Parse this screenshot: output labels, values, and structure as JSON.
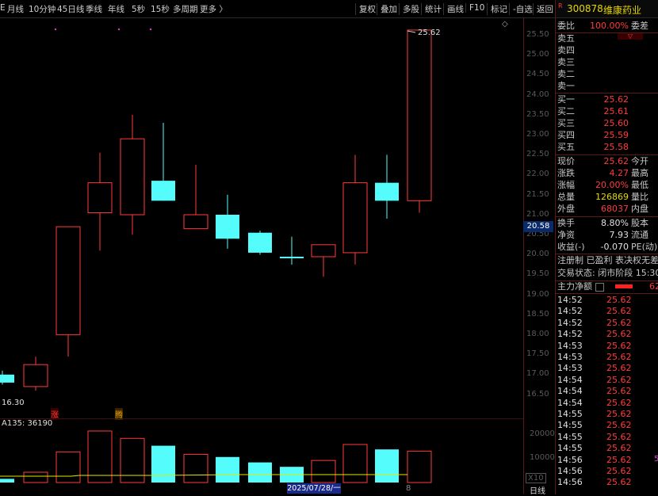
{
  "toolbar": {
    "left": [
      "月线",
      "10分钟",
      "45日线",
      "季线",
      "年线",
      "5秒",
      "15秒",
      "多周期",
      "更多 〉"
    ],
    "right": [
      "复权",
      "叠加",
      "多股",
      "统计",
      "画线",
      "F10",
      "标记",
      "-自选",
      "返回"
    ],
    "left_first": "E"
  },
  "chart": {
    "price_ticks": [
      "25.50",
      "25.00",
      "24.50",
      "24.00",
      "23.50",
      "23.00",
      "22.50",
      "22.00",
      "21.50",
      "21.00",
      "20.50",
      "20.00",
      "19.50",
      "19.00",
      "18.50",
      "18.00",
      "17.50",
      "17.00",
      "16.50"
    ],
    "current_price_box": "20.58",
    "high_label": "25.62",
    "low_label": "16.30",
    "marker_zhang": "涨",
    "marker_teng": "腾",
    "diamond": "◇",
    "vol_label": "A135: 36190",
    "vol_ticks": [
      "20000",
      "10000"
    ],
    "vol_unit": "X10",
    "date": "2025/07/28/一",
    "period_label": "日线",
    "bottom_mark": "8"
  },
  "chart_data": {
    "type": "candlestick",
    "candles": [
      {
        "o": 16.8,
        "c": 17.0,
        "h": 17.1,
        "l": 16.75,
        "color": "cyan"
      },
      {
        "o": 16.7,
        "c": 17.25,
        "h": 17.45,
        "l": 16.6,
        "color": "red"
      },
      {
        "o": 18.0,
        "c": 20.7,
        "h": 20.7,
        "l": 17.45,
        "color": "red"
      },
      {
        "o": 21.05,
        "c": 21.8,
        "h": 22.55,
        "l": 20.1,
        "color": "red"
      },
      {
        "o": 21.0,
        "c": 22.9,
        "h": 23.5,
        "l": 20.5,
        "color": "red"
      },
      {
        "o": 21.85,
        "c": 21.35,
        "h": 23.3,
        "l": 21.35,
        "color": "cyan"
      },
      {
        "o": 20.65,
        "c": 21.0,
        "h": 22.25,
        "l": 20.65,
        "color": "red"
      },
      {
        "o": 21.0,
        "c": 20.4,
        "h": 21.5,
        "l": 20.15,
        "color": "cyan"
      },
      {
        "o": 20.55,
        "c": 20.05,
        "h": 20.6,
        "l": 20.0,
        "color": "cyan"
      },
      {
        "o": 19.95,
        "c": 19.95,
        "h": 20.45,
        "l": 19.75,
        "color": "cyan"
      },
      {
        "o": 19.95,
        "c": 20.25,
        "h": 20.25,
        "l": 19.45,
        "color": "red"
      },
      {
        "o": 20.05,
        "c": 21.8,
        "h": 22.5,
        "l": 19.75,
        "color": "red"
      },
      {
        "o": 21.8,
        "c": 21.35,
        "h": 22.5,
        "l": 20.9,
        "color": "cyan"
      },
      {
        "o": 21.35,
        "c": 25.62,
        "h": 25.62,
        "l": 21.05,
        "color": "red"
      }
    ],
    "volumes": [
      1500,
      4200,
      12500,
      21000,
      18000,
      15000,
      11500,
      10400,
      8200,
      6400,
      9000,
      15500,
      13500,
      12800
    ],
    "vol_colors": [
      "cyan",
      "red",
      "red",
      "red",
      "red",
      "cyan",
      "red",
      "cyan",
      "cyan",
      "cyan",
      "red",
      "red",
      "cyan",
      "red"
    ],
    "ylim": [
      16.2,
      25.8
    ],
    "vol_max": 25000
  },
  "panel": {
    "code": "300878",
    "name": "维康药业",
    "r_badge": "R",
    "weibi_label": "委比",
    "weibi_value": "100.00%",
    "weicha_label": "委差",
    "sell": [
      "卖五",
      "卖四",
      "卖三",
      "卖二",
      "卖一"
    ],
    "buy": [
      {
        "label": "买一",
        "price": "25.62"
      },
      {
        "label": "买二",
        "price": "25.61"
      },
      {
        "label": "买三",
        "price": "25.60"
      },
      {
        "label": "买四",
        "price": "25.59"
      },
      {
        "label": "买五",
        "price": "25.58"
      }
    ],
    "stats": [
      {
        "l": "现价",
        "v": "25.62",
        "r": "今开",
        "cls": "red"
      },
      {
        "l": "涨跌",
        "v": "4.27",
        "r": "最高",
        "cls": "red"
      },
      {
        "l": "涨幅",
        "v": "20.00%",
        "r": "最低",
        "cls": "red"
      },
      {
        "l": "总量",
        "v": "126869",
        "r": "量比",
        "cls": "yellow"
      },
      {
        "l": "外盘",
        "v": "68037",
        "r": "内盘",
        "cls": "red"
      }
    ],
    "stats2": [
      {
        "l": "换手",
        "v": "8.80%",
        "r": "股本",
        "cls": "white"
      },
      {
        "l": "净资",
        "v": "7.93",
        "r": "流通",
        "cls": "white"
      },
      {
        "l": "收益(-)",
        "v": "-0.070",
        "r": "PE(动)",
        "cls": "white"
      }
    ],
    "reg_line": "注册制 已盈利 表决权无差",
    "trade_status": "交易状态: 闭市阶段 15:30",
    "main_flow_label": "主力净额",
    "main_flow_value": "62",
    "ticks": [
      {
        "t": "14:52",
        "p": "25.62"
      },
      {
        "t": "14:52",
        "p": "25.62"
      },
      {
        "t": "14:52",
        "p": "25.62"
      },
      {
        "t": "14:52",
        "p": "25.62"
      },
      {
        "t": "14:53",
        "p": "25.62"
      },
      {
        "t": "14:53",
        "p": "25.62"
      },
      {
        "t": "14:53",
        "p": "25.62"
      },
      {
        "t": "14:54",
        "p": "25.62"
      },
      {
        "t": "14:54",
        "p": "25.62"
      },
      {
        "t": "14:54",
        "p": "25.62"
      },
      {
        "t": "14:55",
        "p": "25.62"
      },
      {
        "t": "14:55",
        "p": "25.62"
      },
      {
        "t": "14:55",
        "p": "25.62"
      },
      {
        "t": "14:55",
        "p": "25.62"
      },
      {
        "t": "14:56",
        "p": "25.62"
      },
      {
        "t": "14:56",
        "p": "25.62"
      },
      {
        "t": "14:56",
        "p": "25.62"
      }
    ],
    "side_mark": "5"
  },
  "colors": {
    "up": "#ff3b3b",
    "down": "#54fcfc",
    "ma": "#e6e600"
  }
}
